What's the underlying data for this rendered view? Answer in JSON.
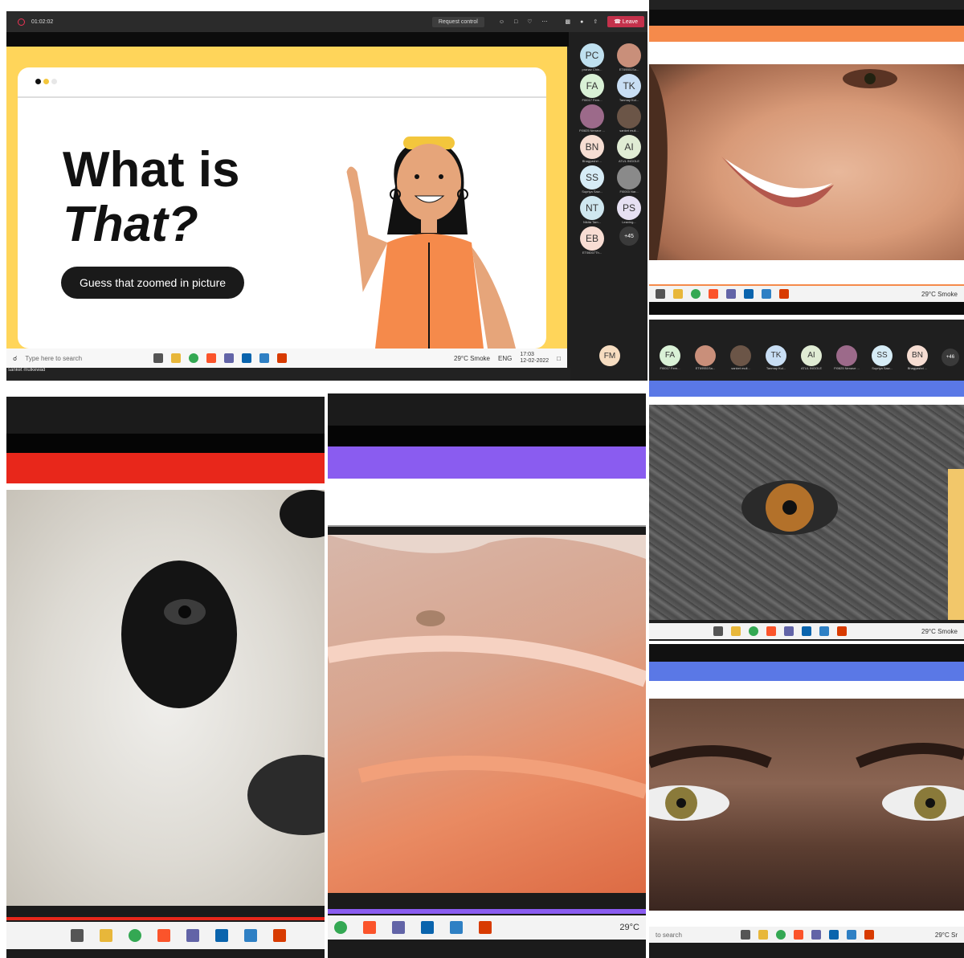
{
  "meeting": {
    "timer": "01:02:02",
    "request_control": "Request control",
    "leave": "Leave"
  },
  "slide": {
    "title_line1": "What is",
    "title_line2": "That?",
    "button": "Guess that zoomed in picture"
  },
  "participants": [
    {
      "initials": "PC",
      "name": "pranav Chin...",
      "color": "#bfe0ef"
    },
    {
      "initials": "",
      "name": "ET69551Sa...",
      "color": "#c98f7a"
    },
    {
      "initials": "FA",
      "name": "FI0017 Fern...",
      "color": "#d9f1d6"
    },
    {
      "initials": "TK",
      "name": "Tanmay Kul...",
      "color": "#c8def4"
    },
    {
      "initials": "",
      "name": "FI0825 Nenave ...",
      "color": "#9c6a8a"
    },
    {
      "initials": "",
      "name": "sanket mull...",
      "color": "#6b5547"
    },
    {
      "initials": "BN",
      "name": "Bhagyashri ...",
      "color": "#f6ddd2"
    },
    {
      "initials": "AI",
      "name": "ATUL INGOLE",
      "color": "#e0ecd4"
    },
    {
      "initials": "SS",
      "name": "Supriya Saw...",
      "color": "#d6ecf6"
    },
    {
      "initials": "",
      "name": "FI0003 Nar...",
      "color": "#8a8a8a"
    },
    {
      "initials": "NT",
      "name": "Nikita Tam...",
      "color": "#cfe7ef"
    },
    {
      "initials": "PS",
      "name": "Leaving...",
      "color": "#e6e0f2"
    },
    {
      "initials": "EB",
      "name": "ET06007Th...",
      "color": "#f8ddd3"
    },
    {
      "initials": "+45",
      "name": "",
      "color": "#3a3a3a"
    }
  ],
  "presenter": {
    "initials": "FM",
    "name": "sanket mulkewad"
  },
  "strip_participants": [
    {
      "initials": "FA",
      "name": "FI0017 Fern...",
      "color": "#d9f1d6"
    },
    {
      "initials": "",
      "name": "ET69551Sa...",
      "color": "#c98f7a"
    },
    {
      "initials": "",
      "name": "sanket mull...",
      "color": "#6b5547"
    },
    {
      "initials": "TK",
      "name": "Tanmay Kul...",
      "color": "#c8def4"
    },
    {
      "initials": "AI",
      "name": "ATUL INGOLE",
      "color": "#e0ecd4"
    },
    {
      "initials": "",
      "name": "FI0825 Nenave ...",
      "color": "#9c6a8a"
    },
    {
      "initials": "SS",
      "name": "Supriya Saw...",
      "color": "#d6ecf6"
    },
    {
      "initials": "BN",
      "name": "Bhagyashri ...",
      "color": "#f6ddd2"
    },
    {
      "initials": "+46",
      "name": "",
      "color": "#3a3a3a"
    }
  ],
  "taskbar": {
    "search_placeholder": "Type here to search",
    "search_partial": "to search",
    "weather": "29°C Smoke",
    "weather_short": "29°C",
    "weather_partial": "29°C Sr",
    "language": "ENG",
    "time": "17:03",
    "date": "12-02-2022"
  },
  "colors": {
    "slide_frame": "#ffd55a",
    "orange_band": "#f58a4b",
    "red_band": "#e8271b",
    "purple_band": "#8a5cf0",
    "blue_band": "#5a78e6",
    "dark": "#1b1b1b"
  }
}
